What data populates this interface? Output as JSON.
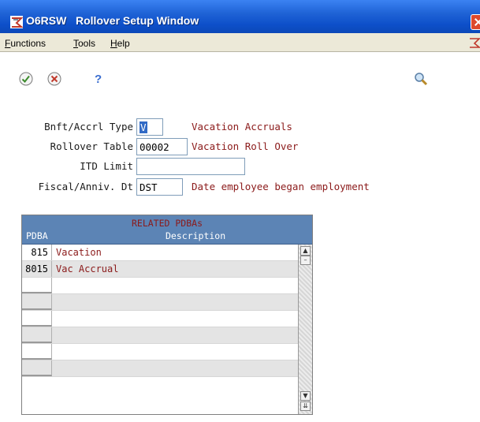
{
  "window": {
    "title": "O6RSW   Rollover Setup Window",
    "logo_icon": "jde-logo-icon"
  },
  "menu": {
    "items": [
      "Functions",
      "Tools",
      "Help"
    ]
  },
  "toolbar": {
    "ok_icon": "checkmark-icon",
    "cancel_icon": "cancel-x-icon",
    "help_icon": "question-mark-icon",
    "search_icon": "magnifier-icon"
  },
  "form": {
    "benefit_accrual_type": {
      "label": "Bnft/Accrl Type",
      "value": "V",
      "description": "Vacation Accruals"
    },
    "rollover_table": {
      "label": "Rollover Table",
      "value": "00002",
      "description": "Vacation Roll Over"
    },
    "itd_limit": {
      "label": "ITD Limit",
      "value": ""
    },
    "fiscal_anniv_date": {
      "label": "Fiscal/Anniv. Dt",
      "value": "DST",
      "description": "Date employee began employment"
    }
  },
  "grid": {
    "title": "RELATED PDBAs",
    "columns": {
      "pdba": "PDBA",
      "description": "Description"
    },
    "rows": [
      {
        "pdba": "815",
        "description": "Vacation"
      },
      {
        "pdba": "8015",
        "description": "Vac Accrual"
      },
      {
        "pdba": "",
        "description": ""
      },
      {
        "pdba": "",
        "description": ""
      },
      {
        "pdba": "",
        "description": ""
      },
      {
        "pdba": "",
        "description": ""
      },
      {
        "pdba": "",
        "description": ""
      },
      {
        "pdba": "",
        "description": ""
      }
    ]
  },
  "colors": {
    "titlebar": "#1f63d6",
    "grid_header": "#5c84b5",
    "desc_text": "#8b1a1a",
    "menubar": "#ece9d8"
  }
}
